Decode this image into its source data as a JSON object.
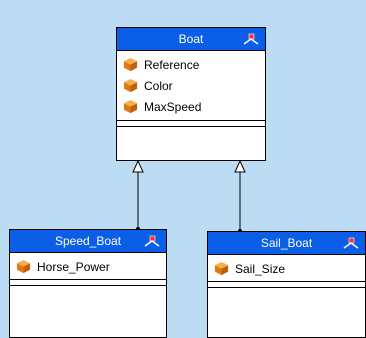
{
  "diagram": {
    "classes": [
      {
        "name": "Boat",
        "attributes": [
          "Reference",
          "Color",
          "MaxSpeed"
        ]
      },
      {
        "name": "Speed_Boat",
        "attributes": [
          "Horse_Power"
        ]
      },
      {
        "name": "Sail_Boat",
        "attributes": [
          "Sail_Size"
        ]
      }
    ],
    "relations": [
      {
        "type": "generalization",
        "from": "Speed_Boat",
        "to": "Boat"
      },
      {
        "type": "generalization",
        "from": "Sail_Boat",
        "to": "Boat"
      }
    ]
  },
  "colors": {
    "background": "#bcdcf4",
    "header": "#0b5fe6",
    "attribute_icon": "#e8861a"
  },
  "icons": {
    "attribute": "package-cube-icon",
    "class_stereotype": "class-stereotype-icon"
  }
}
